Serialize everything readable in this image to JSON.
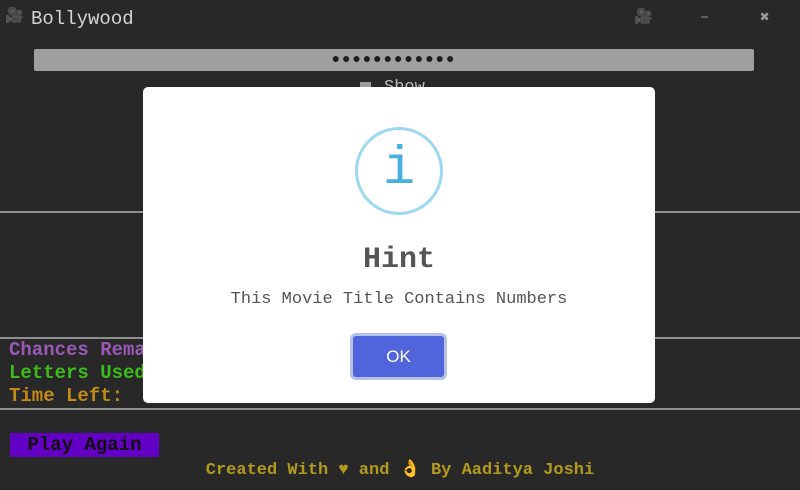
{
  "window": {
    "icon": "🎥",
    "title": "Bollywood",
    "camera_icon": "🎥",
    "minimize_label": "–",
    "close_label": "✖"
  },
  "game": {
    "masked_title": "●●●●●●●●●●●●",
    "show_label": "Show",
    "chances_label": "Chances Remaining:",
    "letters_label": "Letters Used:",
    "time_label": "Time Left:",
    "play_again_label": "Play Again"
  },
  "footer": {
    "text": "Created With ♥ and 👌 By Aaditya Joshi"
  },
  "dialog": {
    "icon_glyph": "i",
    "title": "Hint",
    "message": "This Movie Title Contains Numbers",
    "ok_label": "OK"
  },
  "colors": {
    "background": "#282828",
    "chances": "#9b59b6",
    "letters": "#3dbb1a",
    "time": "#c28a17",
    "play_again_bg": "#6200c4",
    "footer": "#b39a1c",
    "ok_button": "#5064dc",
    "info_icon": "#47b0e0"
  }
}
